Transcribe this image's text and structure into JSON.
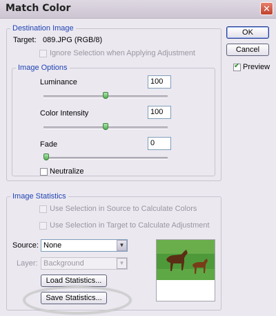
{
  "window": {
    "title": "Match Color",
    "close_glyph": "✕"
  },
  "buttons": {
    "ok": "OK",
    "cancel": "Cancel",
    "preview_label": "Preview",
    "preview_checked": true
  },
  "destination": {
    "legend": "Destination Image",
    "target_label": "Target:",
    "target_value": "089.JPG (RGB/8)",
    "ignore_selection_label": "Ignore Selection when Applying Adjustment",
    "ignore_selection_checked": false
  },
  "image_options": {
    "legend": "Image Options",
    "luminance_label": "Luminance",
    "luminance_value": "100",
    "luminance_level": 0.5,
    "intensity_label": "Color Intensity",
    "intensity_value": "100",
    "intensity_level": 0.5,
    "fade_label": "Fade",
    "fade_value": "0",
    "fade_level": 0,
    "neutralize_label": "Neutralize",
    "neutralize_checked": false
  },
  "image_statistics": {
    "legend": "Image Statistics",
    "use_sel_source_label": "Use Selection in Source to Calculate Colors",
    "use_sel_target_label": "Use Selection in Target to Calculate Adjustment",
    "source_label": "Source:",
    "source_value": "None",
    "layer_label": "Layer:",
    "layer_value": "Background",
    "load_button": "Load Statistics...",
    "save_button": "Save Statistics..."
  },
  "colors": {
    "legend_blue": "#1e43b2",
    "highlight_ellipse": "#cfcfcf"
  },
  "icons": {
    "close": "close-icon",
    "dropdown": "chevron-down-icon",
    "check": "checkmark-icon",
    "preview_image": "horses-thumbnail"
  }
}
